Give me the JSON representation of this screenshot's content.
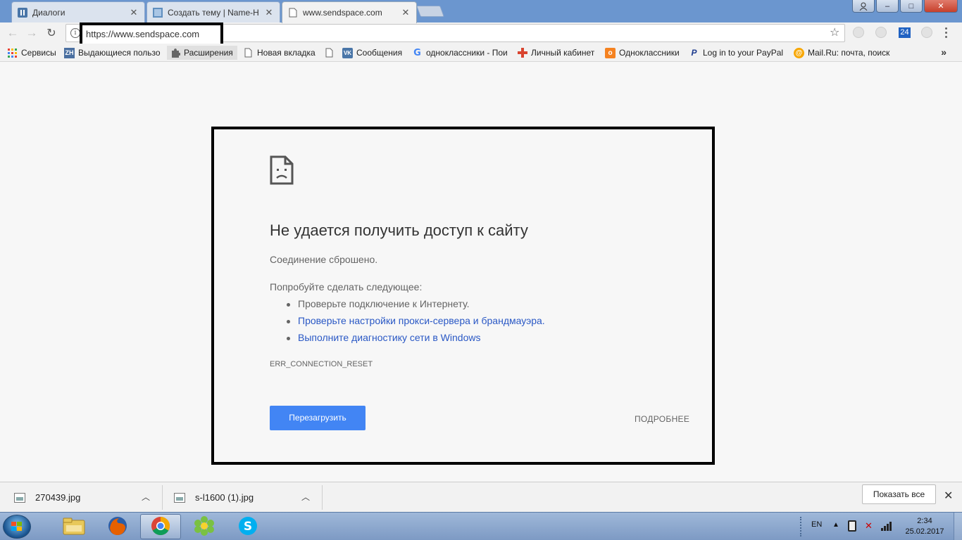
{
  "window": {
    "controls": {
      "minimize": "–",
      "maximize": "□",
      "close": "✕"
    }
  },
  "tabs": [
    {
      "title": "Диалоги",
      "icon": "pause-icon",
      "active": false
    },
    {
      "title": "Создать тему | Name-Ha",
      "icon": "forum-icon",
      "active": false
    },
    {
      "title": "www.sendspace.com",
      "icon": "page-icon",
      "active": true
    }
  ],
  "toolbar": {
    "url": "https://www.sendspace.com",
    "extension_badge": "24"
  },
  "bookmarks": [
    {
      "label": "Сервисы",
      "icon": "apps-grid-icon"
    },
    {
      "label": "Выдающиеся пользо",
      "icon": "zh-icon"
    },
    {
      "label": "Расширения",
      "icon": "puzzle-icon"
    },
    {
      "label": "Новая вкладка",
      "icon": "page-icon"
    },
    {
      "label": "",
      "icon": "page-icon"
    },
    {
      "label": "Сообщения",
      "icon": "vk-icon"
    },
    {
      "label": "одноклассники - Пои",
      "icon": "google-icon"
    },
    {
      "label": "Личный кабинет",
      "icon": "plus-cross-icon"
    },
    {
      "label": "Одноклассники",
      "icon": "ok-icon"
    },
    {
      "label": "Log in to your PayPal",
      "icon": "paypal-icon"
    },
    {
      "label": "Mail.Ru: почта, поиск",
      "icon": "mailru-icon"
    }
  ],
  "error": {
    "title": "Не удается получить доступ к сайту",
    "subtitle": "Соединение сброшено.",
    "try_heading": "Попробуйте сделать следующее:",
    "suggestions": [
      "Проверьте подключение к Интернету.",
      "Проверьте настройки прокси-сервера и брандмауэра.",
      "Выполните диагностику сети в Windows"
    ],
    "code": "ERR_CONNECTION_RESET",
    "reload_label": "Перезагрузить",
    "details_label": "ПОДРОБНЕЕ"
  },
  "downloads": {
    "items": [
      {
        "name": "270439.jpg"
      },
      {
        "name": "s-l1600 (1).jpg"
      }
    ],
    "show_all_label": "Показать все"
  },
  "taskbar": {
    "apps": [
      "explorer-icon",
      "firefox-icon",
      "chrome-icon",
      "icq-icon",
      "skype-icon"
    ],
    "language": "EN",
    "time": "2:34",
    "date": "25.02.2017"
  },
  "colors": {
    "reload_button": "#4285f4",
    "link": "#2a58c5",
    "url_highlight_border": "#000000",
    "error_box_border": "#000000"
  }
}
